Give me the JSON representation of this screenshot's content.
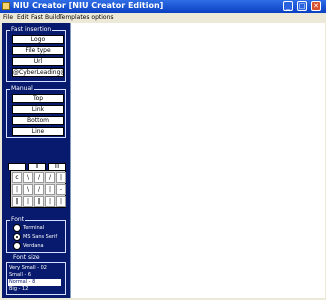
{
  "window": {
    "title": "NIU Creator [NIU Creator Edition]",
    "minimize": "_",
    "maximize": "□",
    "close": "✕"
  },
  "menu": [
    "File",
    "Edit",
    "Fast Build",
    "Templates options"
  ],
  "fast_insertion": {
    "label": "Fast insertion",
    "buttons": [
      "Logo",
      "File type",
      "Url",
      "@CyberLeading@"
    ]
  },
  "manual": {
    "label": "Manual",
    "buttons": [
      "Top",
      "Link",
      "Bottom",
      "Line"
    ]
  },
  "tabs": [
    "",
    "II",
    "III"
  ],
  "char_grid": [
    [
      "c",
      "\\",
      "/",
      "/",
      "|"
    ],
    [
      "|",
      "\\",
      "/",
      "|",
      "-"
    ],
    [
      "‖",
      "|",
      "‖",
      "|",
      "|"
    ]
  ],
  "font": {
    "label": "Font",
    "options": [
      "Terminal",
      "MS Sans Serif",
      "Verdana"
    ],
    "selected": 1
  },
  "font_size": {
    "label": "Font size",
    "items": [
      "Very Small - 02",
      "Small - 6",
      "Normal - 8",
      "Big - 12"
    ],
    "selected": 2
  }
}
